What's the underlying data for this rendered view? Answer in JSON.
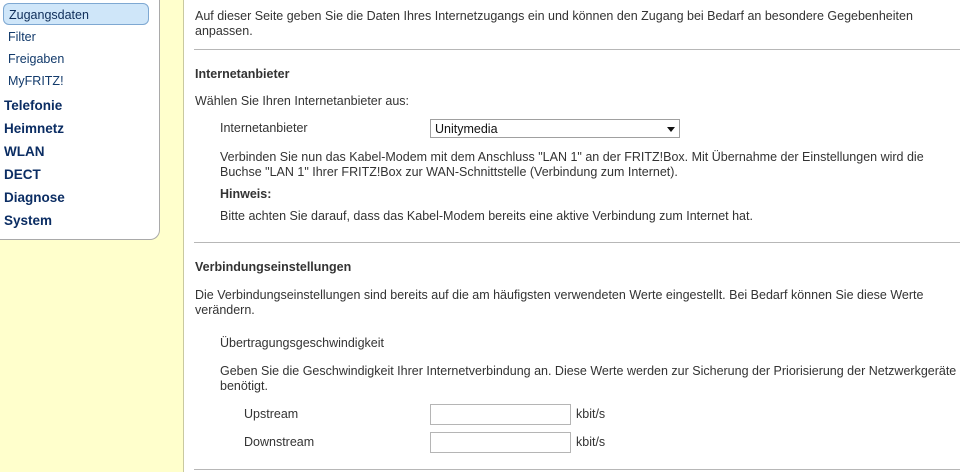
{
  "nav": {
    "sub_items": [
      "Zugangsdaten",
      "Filter",
      "Freigaben",
      "MyFRITZ!"
    ],
    "main_items": [
      "Telefonie",
      "Heimnetz",
      "WLAN",
      "DECT",
      "Diagnose",
      "System"
    ]
  },
  "intro": "Auf dieser Seite geben Sie die Daten Ihres Internetzugangs ein und können den Zugang bei Bedarf an besondere Gegebenheiten anpassen.",
  "provider": {
    "heading": "Internetanbieter",
    "prompt": "Wählen Sie Ihren Internetanbieter aus:",
    "label": "Internetanbieter",
    "selected": "Unitymedia",
    "connect_text": "Verbinden Sie nun das Kabel-Modem mit dem Anschluss \"LAN 1\" an der FRITZ!Box. Mit Übernahme der Einstellungen wird die Buchse \"LAN 1\" Ihrer FRITZ!Box zur WAN-Schnittstelle (Verbindung zum Internet).",
    "hint_title": "Hinweis:",
    "hint_text": "Bitte achten Sie darauf, dass das Kabel-Modem bereits eine aktive Verbindung zum Internet hat."
  },
  "connection": {
    "heading": "Verbindungseinstellungen",
    "desc": "Die Verbindungseinstellungen sind bereits auf die am häufigsten verwendeten Werte eingestellt. Bei Bedarf können Sie diese Werte verändern.",
    "speed_title": "Übertragungsgeschwindigkeit",
    "speed_desc": "Geben Sie die Geschwindigkeit Ihrer Internetverbindung an. Diese Werte werden zur Sicherung der Priorisierung der Netzwerkgeräte benötigt.",
    "upstream_label": "Upstream",
    "upstream_value": "",
    "downstream_label": "Downstream",
    "downstream_value": "",
    "unit": "kbit/s"
  }
}
